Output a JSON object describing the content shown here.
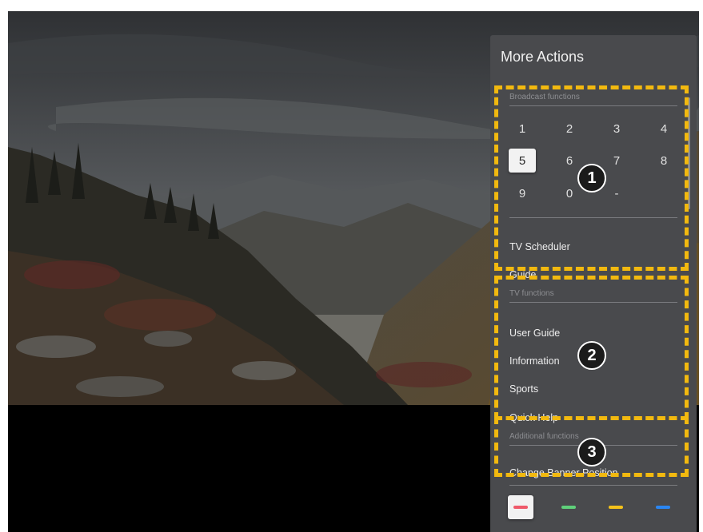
{
  "panel": {
    "title": "More Actions",
    "broadcast_label": "Broadcast functions",
    "number_keys": [
      "1",
      "2",
      "3",
      "4",
      "5",
      "6",
      "7",
      "8",
      "9",
      "0",
      "-"
    ],
    "selected_number": "5",
    "broadcast_items": [
      "TV Scheduler",
      "Guide"
    ],
    "tv_label": "TV functions",
    "tv_items": [
      "User Guide",
      "Information",
      "Sports",
      "Quick Help"
    ],
    "additional_label": "Additional functions",
    "additional_items": [
      "Change Banner Position"
    ],
    "color_buttons": [
      {
        "name": "red",
        "color": "#ef5a6a",
        "selected": true
      },
      {
        "name": "green",
        "color": "#5fd07a",
        "selected": false
      },
      {
        "name": "yellow",
        "color": "#f4c21b",
        "selected": false
      },
      {
        "name": "blue",
        "color": "#2a86f2",
        "selected": false
      }
    ]
  },
  "annotations": {
    "badges": [
      "1",
      "2",
      "3"
    ],
    "highlight_color": "#f2b90f"
  }
}
